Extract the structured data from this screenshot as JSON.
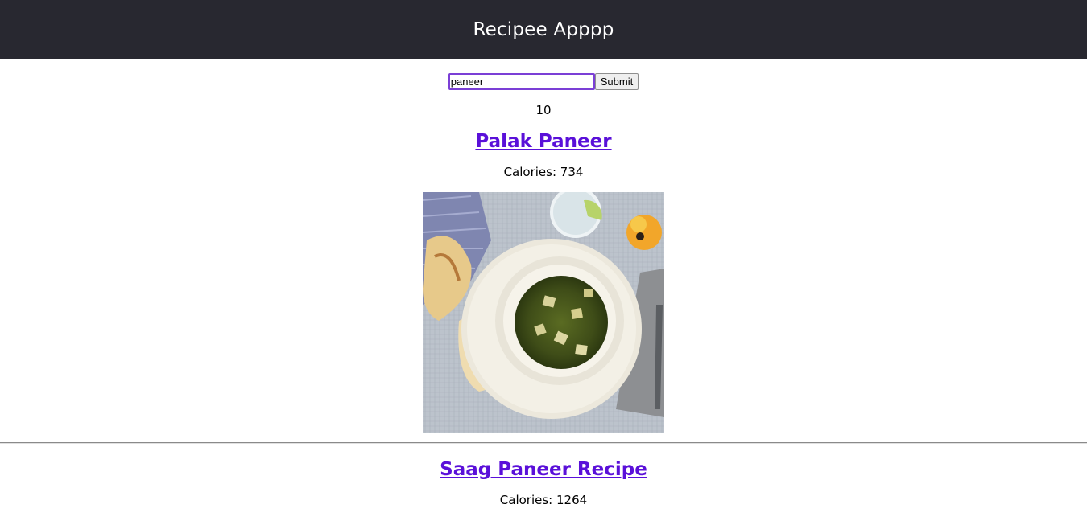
{
  "header": {
    "title": "Recipee Apppp"
  },
  "search": {
    "value": "paneer",
    "submit_label": "Submit"
  },
  "result_count": "10",
  "recipes": [
    {
      "title": "Palak Paneer",
      "calories": "Calories: 734",
      "image_alt": "palak-paneer-photo"
    },
    {
      "title": "Saag Paneer Recipe",
      "calories": "Calories: 1264"
    }
  ],
  "colors": {
    "header_bg": "#282830",
    "link": "#5a10d9",
    "input_border": "#7b3fd6"
  }
}
